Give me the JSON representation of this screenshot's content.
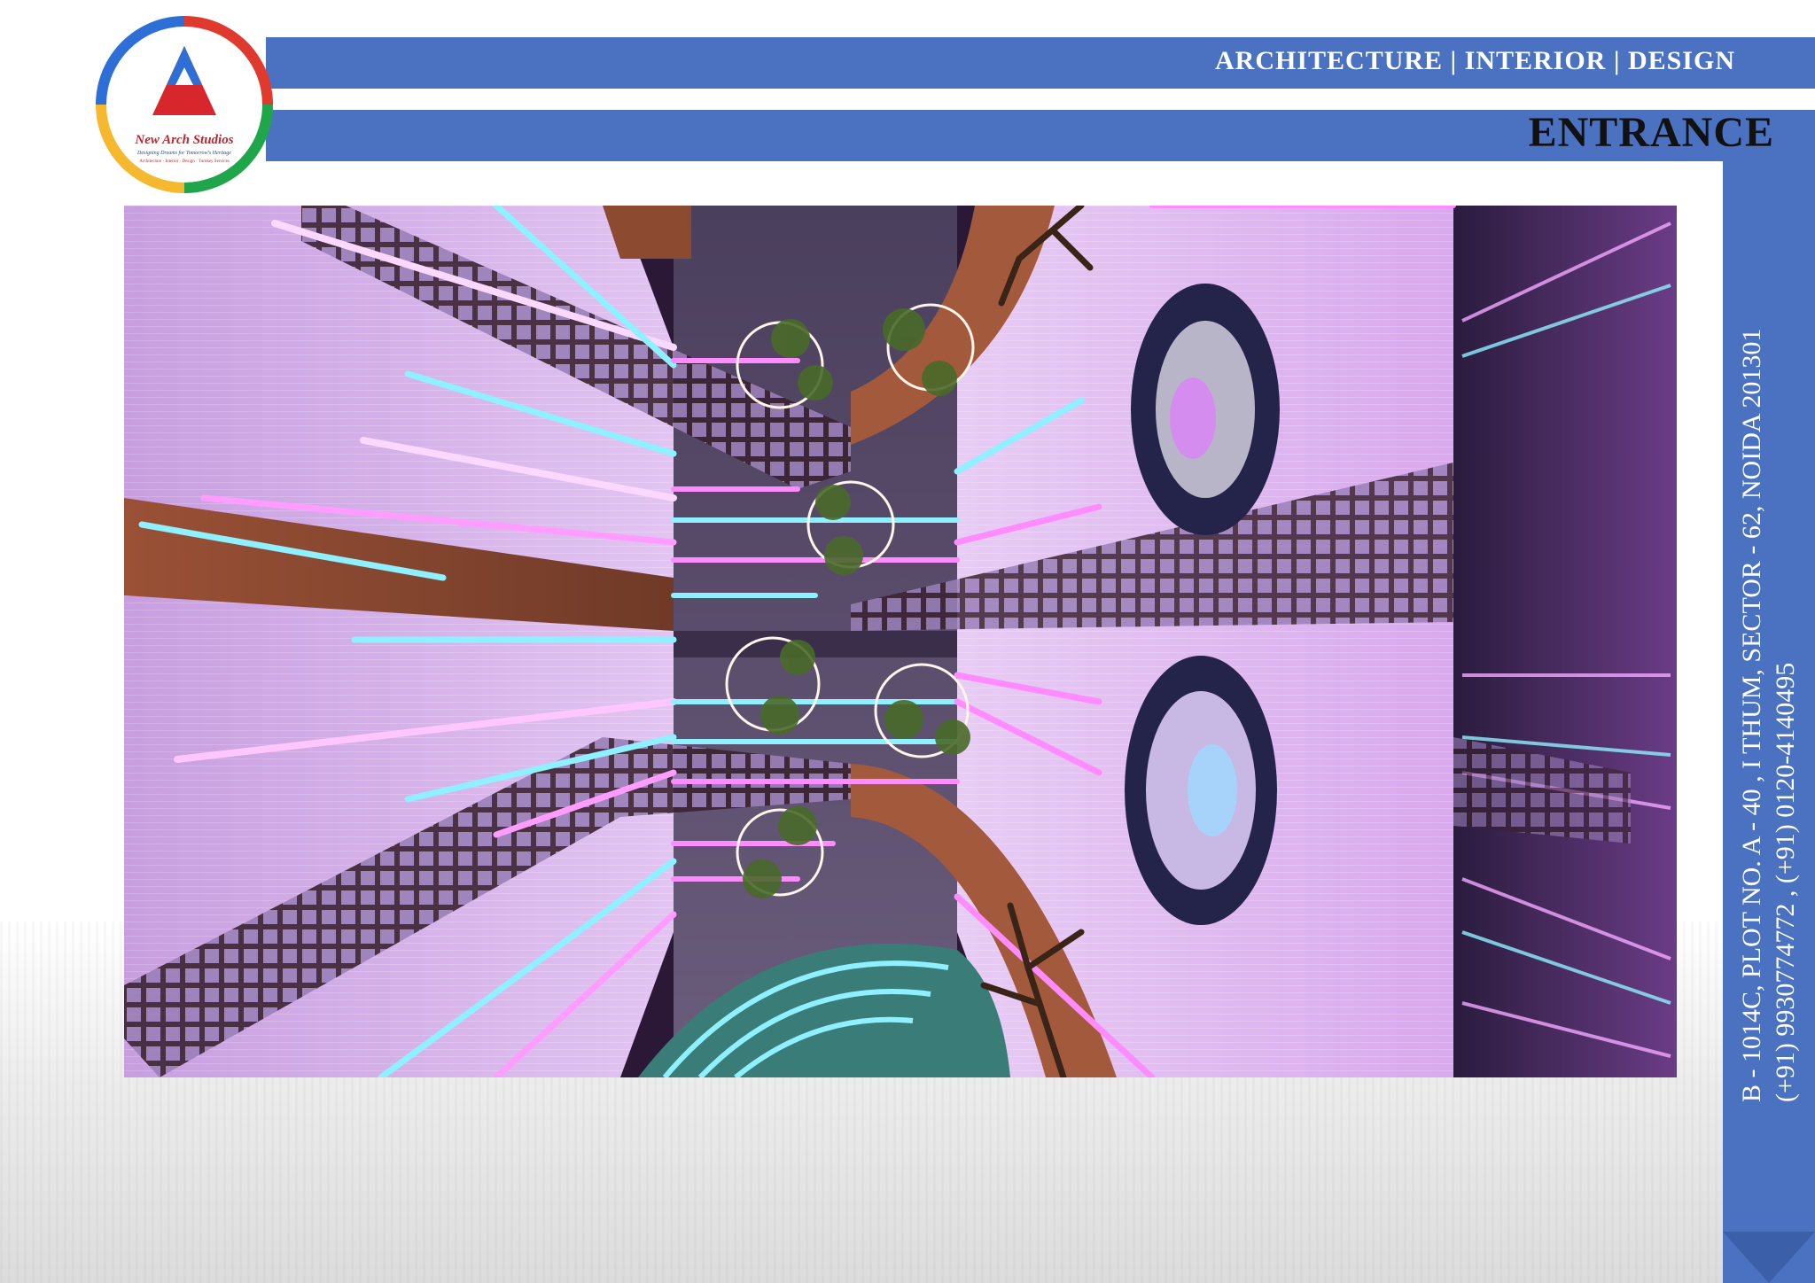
{
  "header": {
    "tagline": "ARCHITECTURE | INTERIOR | DESIGN",
    "section_title": "ENTRANCE"
  },
  "logo": {
    "name": "New Arch Studios",
    "tagline": "Designing Dreams for Tomorrow's Heritage",
    "services": "Architecture · Interior · Design · Turnkey Services"
  },
  "sidebar": {
    "address_line1": "B - 1014C, PLOT NO. A - 40 , I THUM, SECTOR - 62, NOIDA 201301",
    "address_line2": "(+91) 9930774772 , (+91) 0120-4140495"
  },
  "render": {
    "description_icon": "ceiling-render-image"
  },
  "colors": {
    "brand_blue": "#4a72c0",
    "neon_pink": "#e07bff",
    "neon_cyan": "#7ff5ff",
    "wood": "#8a4a32"
  }
}
